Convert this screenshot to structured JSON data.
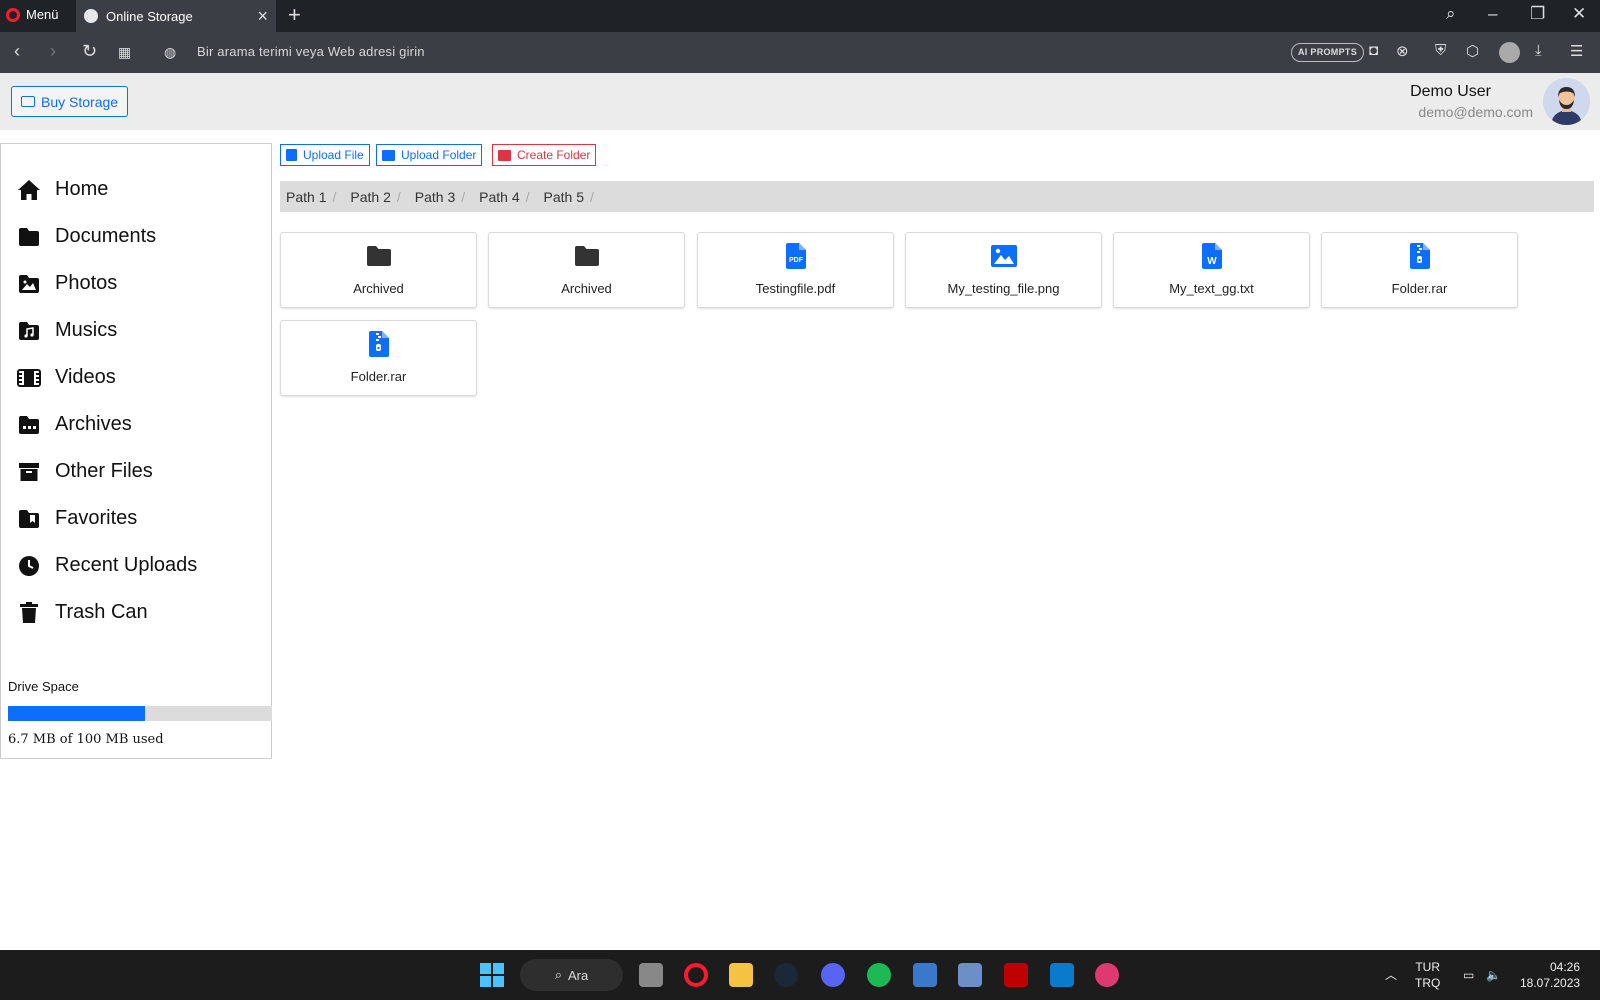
{
  "browser": {
    "menu_label": "Menü",
    "tab_title": "Online Storage",
    "address_placeholder": "Bir arama terimi veya Web adresi girin",
    "ai_prompts_label": "AI PROMPTS"
  },
  "header": {
    "buy_storage_label": "Buy Storage",
    "user_name": "Demo User",
    "user_email": "demo@demo.com"
  },
  "sidebar": {
    "items": [
      {
        "label": "Home",
        "icon": "home-icon"
      },
      {
        "label": "Documents",
        "icon": "folder-icon"
      },
      {
        "label": "Photos",
        "icon": "photos-icon"
      },
      {
        "label": "Musics",
        "icon": "music-icon"
      },
      {
        "label": "Videos",
        "icon": "film-icon"
      },
      {
        "label": "Archives",
        "icon": "archive-folder-icon"
      },
      {
        "label": "Other Files",
        "icon": "box-archive-icon"
      },
      {
        "label": "Favorites",
        "icon": "bookmark-folder-icon"
      },
      {
        "label": "Recent Uploads",
        "icon": "clock-icon"
      },
      {
        "label": "Trash Can",
        "icon": "trash-icon"
      }
    ],
    "drive_space_label": "Drive Space",
    "drive_usage_text": "6.7 MB of 100 MB used",
    "drive_used_fraction": 0.52
  },
  "toolbar": {
    "upload_file_label": "Upload File",
    "upload_folder_label": "Upload Folder",
    "create_folder_label": "Create Folder"
  },
  "breadcrumb": [
    "Path 1",
    "Path 2",
    "Path 3",
    "Path 4",
    "Path 5"
  ],
  "files": [
    {
      "name": "Archived",
      "type": "folder"
    },
    {
      "name": "Archived",
      "type": "folder"
    },
    {
      "name": "Testingfile.pdf",
      "type": "pdf"
    },
    {
      "name": "My_testing_file.png",
      "type": "image"
    },
    {
      "name": "My_text_gg.txt",
      "type": "word"
    },
    {
      "name": "Folder.rar",
      "type": "zip"
    },
    {
      "name": "Folder.rar",
      "type": "zip"
    }
  ],
  "taskbar": {
    "search_label": "Ara",
    "lang_top": "TUR",
    "lang_bottom": "TRQ",
    "time": "04:26",
    "date": "18.07.2023"
  },
  "colors": {
    "primary": "#0d6efd",
    "danger": "#dc3545",
    "chrome_dark": "#1f2227"
  }
}
